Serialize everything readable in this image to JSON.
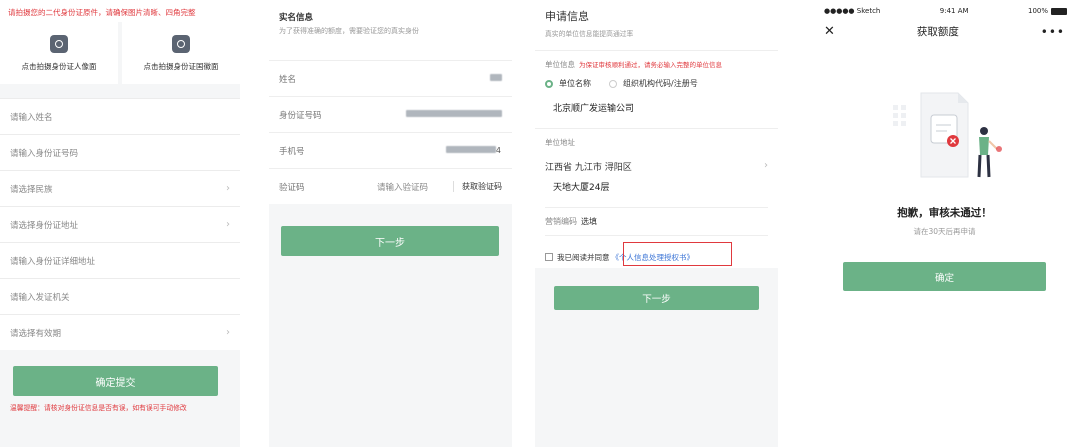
{
  "panel1": {
    "warning": "请拍摄您的二代身份证原件，请确保图片清晰、四角完整",
    "upload_front": "点击拍摄身份证人像面",
    "upload_back": "点击拍摄身份证国徽面",
    "fields": [
      {
        "label": "请输入姓名",
        "chevron": false
      },
      {
        "label": "请输入身份证号码",
        "chevron": false
      },
      {
        "label": "请选择民族",
        "chevron": true
      },
      {
        "label": "请选择身份证地址",
        "chevron": true
      },
      {
        "label": "请输入身份证详细地址",
        "chevron": false
      },
      {
        "label": "请输入发证机关",
        "chevron": false
      },
      {
        "label": "请选择有效期",
        "chevron": true
      }
    ],
    "submit": "确定提交",
    "footer": "温馨提醒：请核对身份证信息是否有误，如有误可手动修改"
  },
  "panel2": {
    "title": "实名信息",
    "subtitle": "为了获得准确的额度，需要验证您的真实身份",
    "rows": {
      "name": "姓名",
      "id": "身份证号码",
      "phone": "手机号",
      "phone_suffix": "4",
      "code": "验证码"
    },
    "code_placeholder": "请输入验证码",
    "get_code": "获取验证码",
    "next": "下一步"
  },
  "panel3": {
    "title": "申请信息",
    "subtitle": "真实的单位信息能提高通过率",
    "unit_label": "单位信息",
    "unit_note": "为保证审核顺利通过，请务必输入完整的单位信息",
    "radio_name": "单位名称",
    "radio_code": "组织机构代码/注册号",
    "company": "北京顺广发运输公司",
    "addr_label": "单位地址",
    "addr_region": "江西省 九江市 浔阳区",
    "addr_detail": "天地大厦24层",
    "mk_label": "营销编码",
    "mk_value": "选填",
    "agree_text": "我已阅读并同意",
    "agree_link": "《个人信息处理授权书》",
    "next": "下一步"
  },
  "panel4": {
    "carrier": "●●●●● Sketch",
    "time": "9:41 AM",
    "battery": "100%",
    "nav_title": "获取额度",
    "fail_title": "抱歉，审核未通过！",
    "fail_sub": "请在30天后再申请",
    "confirm": "确定",
    "colors": {
      "accent": "#6bb287",
      "error": "#e0393e",
      "link": "#3b74d6"
    }
  }
}
